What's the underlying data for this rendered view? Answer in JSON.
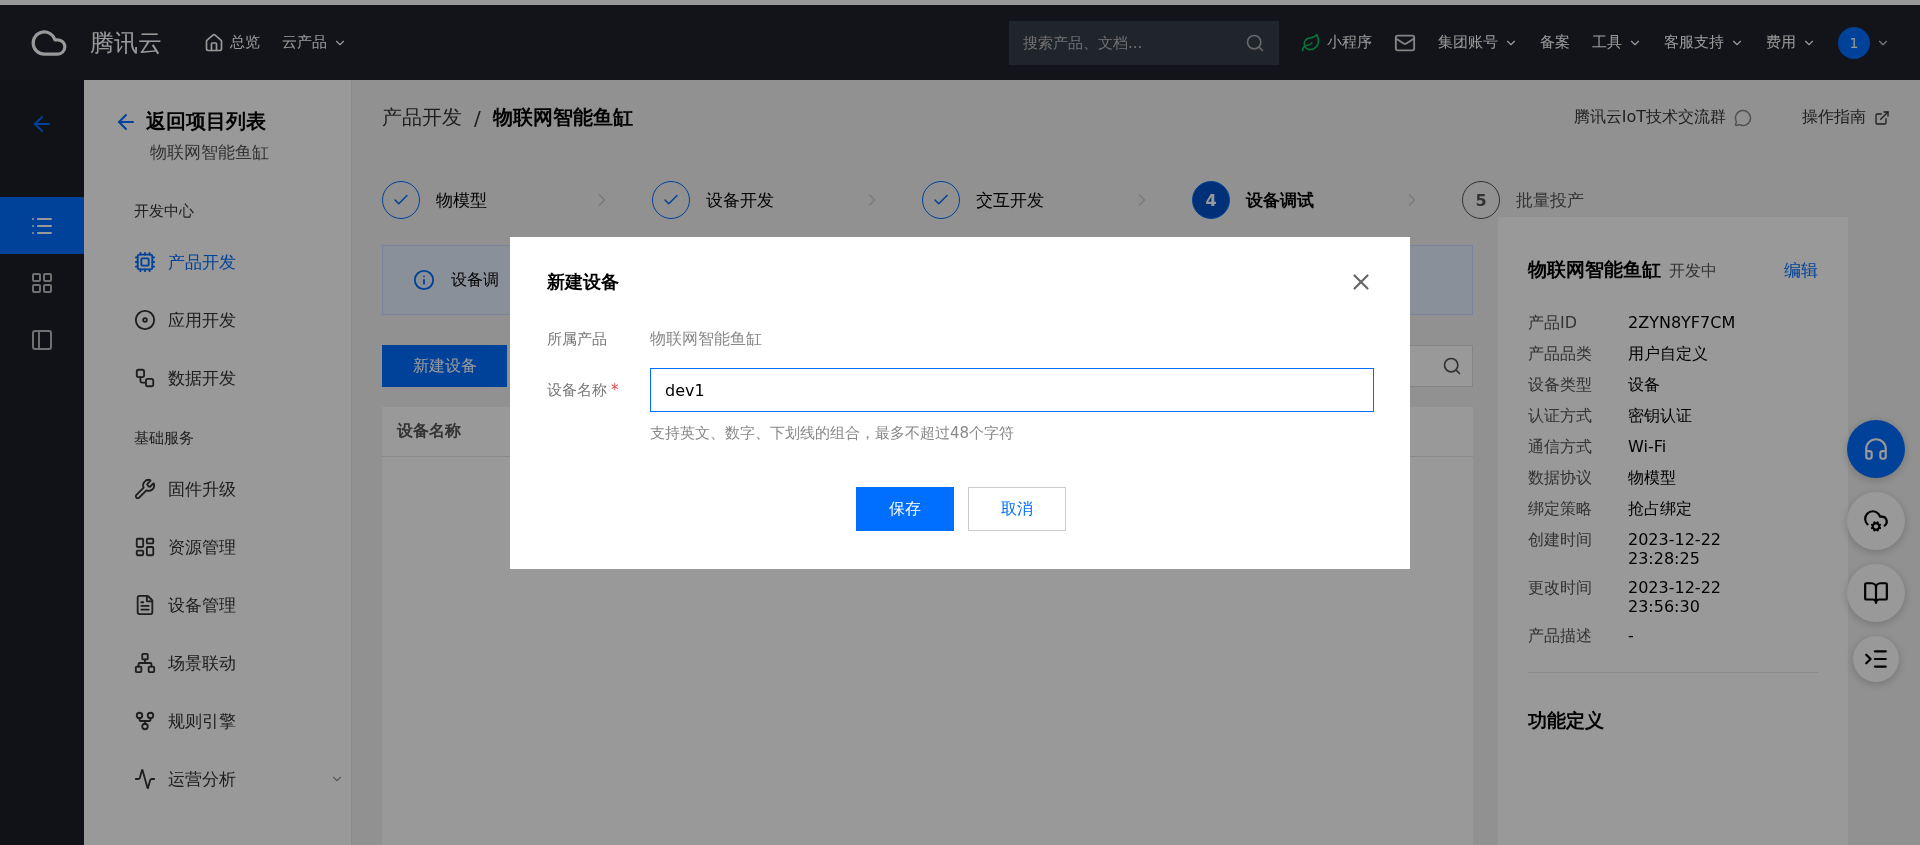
{
  "topbar": {
    "brand": "腾讯云",
    "nav": [
      {
        "label": "总览",
        "kind": "home"
      },
      {
        "label": "云产品",
        "kind": "dropdown"
      }
    ],
    "search": {
      "placeholder": "搜索产品、文档..."
    },
    "right": [
      {
        "label": "小程序",
        "kind": "miniapp"
      },
      {
        "kind": "mail"
      },
      {
        "label": "集团账号",
        "kind": "dropdown"
      },
      {
        "label": "备案",
        "kind": "plain"
      },
      {
        "label": "工具",
        "kind": "dropdown"
      },
      {
        "label": "客服支持",
        "kind": "dropdown"
      },
      {
        "label": "费用",
        "kind": "dropdown"
      }
    ],
    "avatar": "1"
  },
  "rail": [
    {
      "kind": "back",
      "selected": false
    },
    {
      "kind": "list",
      "selected": true
    },
    {
      "kind": "grid",
      "selected": false
    },
    {
      "kind": "panel",
      "selected": false
    }
  ],
  "sidebar": {
    "back": "返回项目列表",
    "project": "物联网智能鱼缸",
    "groups": [
      {
        "title": "开发中心",
        "items": [
          {
            "label": "产品开发",
            "kind": "chip",
            "selected": true
          },
          {
            "label": "应用开发",
            "kind": "app",
            "selected": false
          },
          {
            "label": "数据开发",
            "kind": "data",
            "selected": false
          }
        ]
      },
      {
        "title": "基础服务",
        "items": [
          {
            "label": "固件升级",
            "kind": "firmware",
            "selected": false
          },
          {
            "label": "资源管理",
            "kind": "resource",
            "selected": false
          },
          {
            "label": "设备管理",
            "kind": "device",
            "selected": false
          },
          {
            "label": "场景联动",
            "kind": "scene",
            "selected": false
          },
          {
            "label": "规则引擎",
            "kind": "rule",
            "selected": false
          },
          {
            "label": "运营分析",
            "kind": "analytics",
            "selected": false,
            "expanded": false
          }
        ]
      }
    ]
  },
  "breadcrumb": [
    "产品开发",
    "/",
    "物联网智能鱼缸"
  ],
  "header_links": [
    {
      "label": "腾讯云IoT技术交流群",
      "kind": "chat"
    },
    {
      "label": "操作指南",
      "kind": "external"
    }
  ],
  "steps": [
    {
      "label": "物模型",
      "completed": true,
      "selected": false
    },
    {
      "label": "设备开发",
      "completed": true,
      "selected": false
    },
    {
      "label": "交互开发",
      "completed": true,
      "selected": false
    },
    {
      "number": "4",
      "label": "设备调试",
      "completed": false,
      "selected": true
    },
    {
      "number": "5",
      "label": "批量投产",
      "completed": false,
      "selected": false
    }
  ],
  "banner": {
    "text": "设备调"
  },
  "toolbar": {
    "button": "新建设备"
  },
  "table": {
    "columns": [
      "设备名称"
    ]
  },
  "product_panel": {
    "name": "物联网智能鱼缸",
    "status": "开发中",
    "edit": "编辑",
    "fields": [
      {
        "label": "产品ID",
        "value": "2ZYN8YF7CM"
      },
      {
        "label": "产品品类",
        "value": "用户自定义"
      },
      {
        "label": "设备类型",
        "value": "设备"
      },
      {
        "label": "认证方式",
        "value": "密钥认证"
      },
      {
        "label": "通信方式",
        "value": "Wi-Fi"
      },
      {
        "label": "数据协议",
        "value": "物模型"
      },
      {
        "label": "绑定策略",
        "value": "抢占绑定"
      },
      {
        "label": "创建时间",
        "value": "2023-12-22 23:28:25"
      },
      {
        "label": "更改时间",
        "value": "2023-12-22 23:56:30"
      },
      {
        "label": "产品描述",
        "value": "-"
      }
    ],
    "section": "功能定义"
  },
  "float_buttons": [
    {
      "kind": "support",
      "selected": true
    },
    {
      "kind": "cloud",
      "selected": false
    },
    {
      "kind": "book",
      "selected": false
    },
    {
      "kind": "indent",
      "selected": false
    }
  ],
  "dialog": {
    "title": "新建设备",
    "rows": [
      {
        "label": "所属产品",
        "kind": "text",
        "value": "物联网智能鱼缸"
      },
      {
        "label": "设备名称",
        "kind": "input",
        "value": "dev1",
        "required_mark": "*",
        "hint": "支持英文、数字、下划线的组合，最多不超过48个字符"
      }
    ],
    "buttons": [
      {
        "label": "保存",
        "kind": "primary"
      },
      {
        "label": "取消",
        "kind": "default"
      }
    ]
  }
}
